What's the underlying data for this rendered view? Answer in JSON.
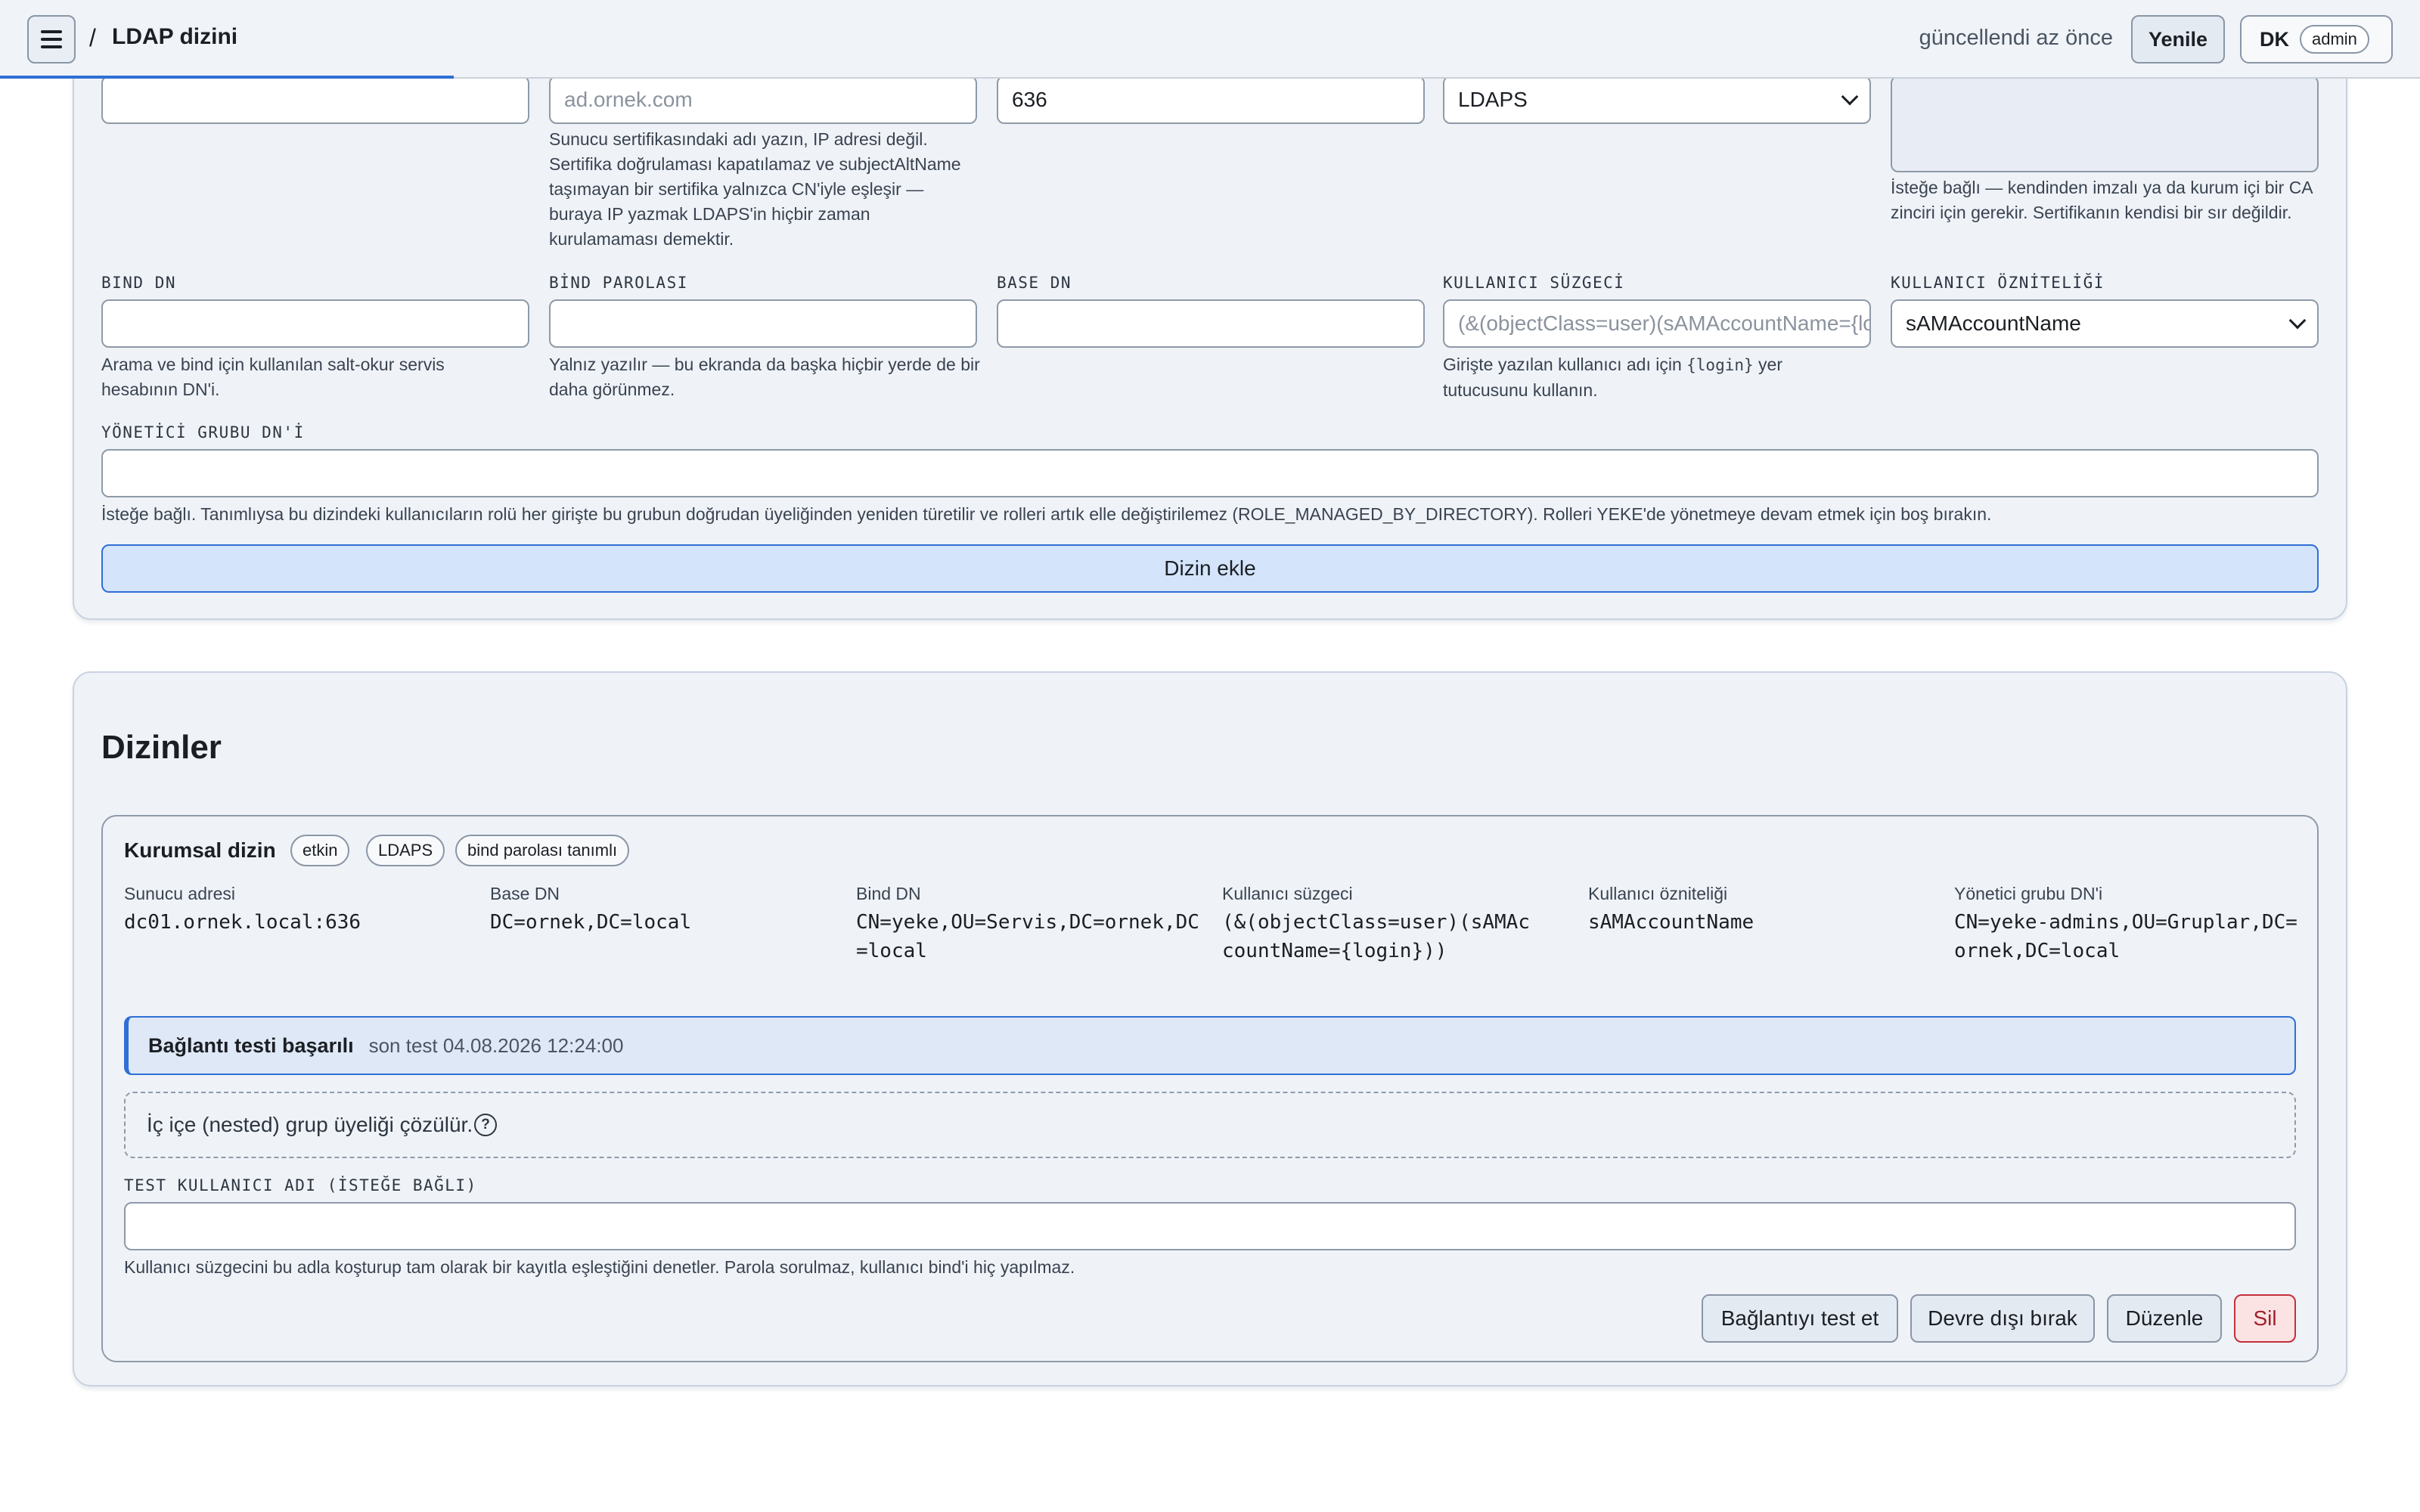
{
  "topbar": {
    "breadcrumb_sep": "/",
    "title": "LDAP dizini",
    "updated": "güncellendi az önce",
    "refresh_label": "Yenile",
    "user_initials": "DK",
    "user_role": "admin"
  },
  "form": {
    "server_host": {
      "value": ""
    },
    "server_name": {
      "placeholder": "ad.ornek.com",
      "help": "Sunucu sertifikasındaki adı yazın, IP adresi değil. Sertifika doğrulaması kapatılamaz ve subjectAltName taşımayan bir sertifika yalnızca CN'iyle eşleşir — buraya IP yazmak LDAPS'in hiçbir zaman kurulamaması demektir."
    },
    "port": {
      "value": "636"
    },
    "protocol": {
      "value": "LDAPS"
    },
    "ca_cert": {
      "help": "İsteğe bağlı — kendinden imzalı ya da kurum içi bir CA zinciri için gerekir. Sertifikanın kendisi bir sır değildir."
    },
    "bind_dn": {
      "label": "BIND DN",
      "value": "",
      "help": "Arama ve bind için kullanılan salt-okur servis hesabının DN'i."
    },
    "bind_password": {
      "label": "BİND PAROLASI",
      "value": "",
      "help": "Yalnız yazılır — bu ekranda da başka hiçbir yerde de bir daha görünmez."
    },
    "base_dn": {
      "label": "BASE DN",
      "value": ""
    },
    "user_filter": {
      "label": "KULLANICI SÜZGECİ",
      "placeholder": "(&(objectClass=user)(sAMAccountName={login}))",
      "help_pre": "Girişte yazılan kullanıcı adı için ",
      "help_code": "{login}",
      "help_post": " yer tutucusunu kullanın."
    },
    "user_attribute": {
      "label": "KULLANICI ÖZNİTELİĞİ",
      "value": "sAMAccountName"
    },
    "admin_group_dn": {
      "label": "YÖNETİCİ GRUBU DN'İ",
      "value": "",
      "help": "İsteğe bağlı. Tanımlıysa bu dizindeki kullanıcıların rolü her girişte bu grubun doğrudan üyeliğinden yeniden türetilir ve rolleri artık elle değiştirilemez (ROLE_MANAGED_BY_DIRECTORY). Rolleri YEKE'de yönetmeye devam etmek için boş bırakın."
    },
    "submit_label": "Dizin ekle"
  },
  "directories": {
    "heading": "Dizinler",
    "items": [
      {
        "name": "Kurumsal dizin",
        "chips": [
          "etkin",
          "LDAPS",
          "bind parolası tanımlı"
        ],
        "fields": [
          {
            "label": "Sunucu adresi",
            "value": "dc01.ornek.local:636"
          },
          {
            "label": "Base DN",
            "value": "DC=ornek,DC=local"
          },
          {
            "label": "Bind DN",
            "value": "CN=yeke,OU=Servis,DC=ornek,DC=local"
          },
          {
            "label": "Kullanıcı süzgeci",
            "value": "(&(objectClass=user)(sAMAccountName={login}))"
          },
          {
            "label": "Kullanıcı özniteliği",
            "value": "sAMAccountName"
          },
          {
            "label": "Yönetici grubu DN'i",
            "value": "CN=yeke-admins,OU=Gruplar,DC=ornek,DC=local"
          }
        ],
        "status_title": "Bağlantı testi başarılı",
        "status_meta": "son test 04.08.2026 12:24:00",
        "nested_text": "İç içe (nested) grup üyeliği çözülür.",
        "nested_help_glyph": "?",
        "test_user": {
          "label": "TEST KULLANICI ADI (İSTEĞE BAĞLI)",
          "value": "",
          "help": "Kullanıcı süzgecini bu adla koşturup tam olarak bir kayıtla eşleştiğini denetler. Parola sorulmaz, kullanıcı bind'i hiç yapılmaz."
        },
        "actions": {
          "test": "Bağlantıyı test et",
          "disable": "Devre dışı bırak",
          "edit": "Düzenle",
          "delete": "Sil"
        }
      }
    ]
  },
  "colors": {
    "accent": "#2f6fd6",
    "danger": "#c2303a",
    "card_bg": "#eff3f8"
  }
}
